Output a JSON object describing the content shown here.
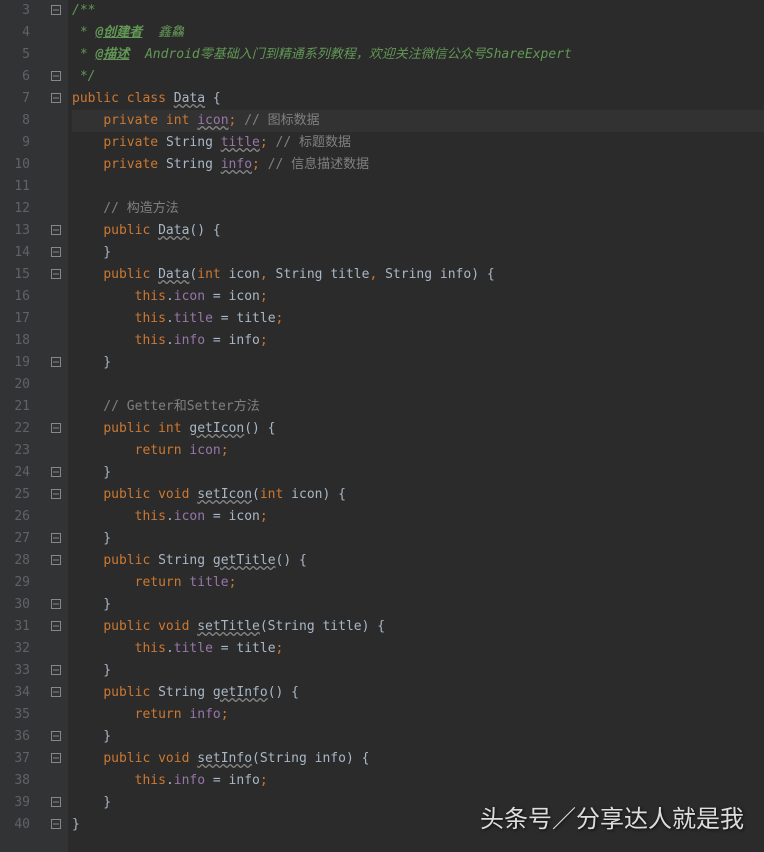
{
  "lineStart": 3,
  "lineEnd": 40,
  "highlightedLine": 8,
  "foldIcons": [
    {
      "line": 3,
      "type": "open"
    },
    {
      "line": 6,
      "type": "close"
    },
    {
      "line": 7,
      "type": "open"
    },
    {
      "line": 13,
      "type": "open"
    },
    {
      "line": 14,
      "type": "close"
    },
    {
      "line": 15,
      "type": "open"
    },
    {
      "line": 19,
      "type": "close"
    },
    {
      "line": 22,
      "type": "open"
    },
    {
      "line": 24,
      "type": "close"
    },
    {
      "line": 25,
      "type": "open"
    },
    {
      "line": 27,
      "type": "close"
    },
    {
      "line": 28,
      "type": "open"
    },
    {
      "line": 30,
      "type": "close"
    },
    {
      "line": 31,
      "type": "open"
    },
    {
      "line": 33,
      "type": "close"
    },
    {
      "line": 34,
      "type": "open"
    },
    {
      "line": 36,
      "type": "close"
    },
    {
      "line": 37,
      "type": "open"
    },
    {
      "line": 39,
      "type": "close"
    },
    {
      "line": 40,
      "type": "close"
    }
  ],
  "code": [
    {
      "n": 3,
      "tokens": [
        {
          "t": "/**",
          "c": "c-doc"
        }
      ]
    },
    {
      "n": 4,
      "tokens": [
        {
          "t": " * ",
          "c": "c-doc"
        },
        {
          "t": "@创建者",
          "c": "c-doctag"
        },
        {
          "t": "  鑫鱻",
          "c": "c-doc"
        }
      ]
    },
    {
      "n": 5,
      "tokens": [
        {
          "t": " * ",
          "c": "c-doc"
        },
        {
          "t": "@描述",
          "c": "c-doctag"
        },
        {
          "t": "  Android零基础入门到精通系列教程，欢迎关注微信公众号ShareExpert",
          "c": "c-doc"
        }
      ]
    },
    {
      "n": 6,
      "tokens": [
        {
          "t": " */",
          "c": "c-doc"
        }
      ]
    },
    {
      "n": 7,
      "tokens": [
        {
          "t": "public class ",
          "c": "c-keyword"
        },
        {
          "t": "Data",
          "c": "c-plain c-underline"
        },
        {
          "t": " {",
          "c": "c-plain"
        }
      ]
    },
    {
      "n": 8,
      "tokens": [
        {
          "t": "    ",
          "c": ""
        },
        {
          "t": "private int ",
          "c": "c-keyword"
        },
        {
          "t": "icon",
          "c": "c-field c-underline"
        },
        {
          "t": ";",
          "c": "c-semicolon"
        },
        {
          "t": " // 图标数据",
          "c": "c-comment"
        }
      ]
    },
    {
      "n": 9,
      "tokens": [
        {
          "t": "    ",
          "c": ""
        },
        {
          "t": "private ",
          "c": "c-keyword"
        },
        {
          "t": "String ",
          "c": "c-plain"
        },
        {
          "t": "title",
          "c": "c-field c-underline"
        },
        {
          "t": ";",
          "c": "c-semicolon"
        },
        {
          "t": " // 标题数据",
          "c": "c-comment"
        }
      ]
    },
    {
      "n": 10,
      "tokens": [
        {
          "t": "    ",
          "c": ""
        },
        {
          "t": "private ",
          "c": "c-keyword"
        },
        {
          "t": "String ",
          "c": "c-plain"
        },
        {
          "t": "info",
          "c": "c-field c-underline"
        },
        {
          "t": ";",
          "c": "c-semicolon"
        },
        {
          "t": " // 信息描述数据",
          "c": "c-comment"
        }
      ]
    },
    {
      "n": 11,
      "tokens": []
    },
    {
      "n": 12,
      "tokens": [
        {
          "t": "    // 构造方法",
          "c": "c-comment"
        }
      ]
    },
    {
      "n": 13,
      "tokens": [
        {
          "t": "    ",
          "c": ""
        },
        {
          "t": "public ",
          "c": "c-keyword"
        },
        {
          "t": "Data",
          "c": "c-plain c-underline"
        },
        {
          "t": "() {",
          "c": "c-plain"
        }
      ]
    },
    {
      "n": 14,
      "tokens": [
        {
          "t": "    }",
          "c": "c-plain"
        }
      ]
    },
    {
      "n": 15,
      "tokens": [
        {
          "t": "    ",
          "c": ""
        },
        {
          "t": "public ",
          "c": "c-keyword"
        },
        {
          "t": "Data",
          "c": "c-plain c-underline"
        },
        {
          "t": "(",
          "c": "c-plain"
        },
        {
          "t": "int ",
          "c": "c-keyword"
        },
        {
          "t": "icon",
          "c": "c-plain"
        },
        {
          "t": ", ",
          "c": "c-semicolon"
        },
        {
          "t": "String title",
          "c": "c-plain"
        },
        {
          "t": ", ",
          "c": "c-semicolon"
        },
        {
          "t": "String info) {",
          "c": "c-plain"
        }
      ]
    },
    {
      "n": 16,
      "tokens": [
        {
          "t": "        ",
          "c": ""
        },
        {
          "t": "this",
          "c": "c-keyword"
        },
        {
          "t": ".",
          "c": "c-dot"
        },
        {
          "t": "icon",
          "c": "c-field"
        },
        {
          "t": " = icon",
          "c": "c-plain"
        },
        {
          "t": ";",
          "c": "c-semicolon"
        }
      ]
    },
    {
      "n": 17,
      "tokens": [
        {
          "t": "        ",
          "c": ""
        },
        {
          "t": "this",
          "c": "c-keyword"
        },
        {
          "t": ".",
          "c": "c-dot"
        },
        {
          "t": "title",
          "c": "c-field"
        },
        {
          "t": " = title",
          "c": "c-plain"
        },
        {
          "t": ";",
          "c": "c-semicolon"
        }
      ]
    },
    {
      "n": 18,
      "tokens": [
        {
          "t": "        ",
          "c": ""
        },
        {
          "t": "this",
          "c": "c-keyword"
        },
        {
          "t": ".",
          "c": "c-dot"
        },
        {
          "t": "info",
          "c": "c-field"
        },
        {
          "t": " = info",
          "c": "c-plain"
        },
        {
          "t": ";",
          "c": "c-semicolon"
        }
      ]
    },
    {
      "n": 19,
      "tokens": [
        {
          "t": "    }",
          "c": "c-plain"
        }
      ]
    },
    {
      "n": 20,
      "tokens": []
    },
    {
      "n": 21,
      "tokens": [
        {
          "t": "    // Getter和Setter方法",
          "c": "c-comment"
        }
      ]
    },
    {
      "n": 22,
      "tokens": [
        {
          "t": "    ",
          "c": ""
        },
        {
          "t": "public int ",
          "c": "c-keyword"
        },
        {
          "t": "getIcon",
          "c": "c-plain c-underline"
        },
        {
          "t": "() {",
          "c": "c-plain"
        }
      ]
    },
    {
      "n": 23,
      "tokens": [
        {
          "t": "        ",
          "c": ""
        },
        {
          "t": "return ",
          "c": "c-keyword"
        },
        {
          "t": "icon",
          "c": "c-field"
        },
        {
          "t": ";",
          "c": "c-semicolon"
        }
      ]
    },
    {
      "n": 24,
      "tokens": [
        {
          "t": "    }",
          "c": "c-plain"
        }
      ]
    },
    {
      "n": 25,
      "tokens": [
        {
          "t": "    ",
          "c": ""
        },
        {
          "t": "public void ",
          "c": "c-keyword"
        },
        {
          "t": "setIcon",
          "c": "c-plain c-underline"
        },
        {
          "t": "(",
          "c": "c-plain"
        },
        {
          "t": "int ",
          "c": "c-keyword"
        },
        {
          "t": "icon) {",
          "c": "c-plain"
        }
      ]
    },
    {
      "n": 26,
      "tokens": [
        {
          "t": "        ",
          "c": ""
        },
        {
          "t": "this",
          "c": "c-keyword"
        },
        {
          "t": ".",
          "c": "c-dot"
        },
        {
          "t": "icon",
          "c": "c-field"
        },
        {
          "t": " = icon",
          "c": "c-plain"
        },
        {
          "t": ";",
          "c": "c-semicolon"
        }
      ]
    },
    {
      "n": 27,
      "tokens": [
        {
          "t": "    }",
          "c": "c-plain"
        }
      ]
    },
    {
      "n": 28,
      "tokens": [
        {
          "t": "    ",
          "c": ""
        },
        {
          "t": "public ",
          "c": "c-keyword"
        },
        {
          "t": "String ",
          "c": "c-plain"
        },
        {
          "t": "getTitle",
          "c": "c-plain c-underline"
        },
        {
          "t": "() {",
          "c": "c-plain"
        }
      ]
    },
    {
      "n": 29,
      "tokens": [
        {
          "t": "        ",
          "c": ""
        },
        {
          "t": "return ",
          "c": "c-keyword"
        },
        {
          "t": "title",
          "c": "c-field"
        },
        {
          "t": ";",
          "c": "c-semicolon"
        }
      ]
    },
    {
      "n": 30,
      "tokens": [
        {
          "t": "    }",
          "c": "c-plain"
        }
      ]
    },
    {
      "n": 31,
      "tokens": [
        {
          "t": "    ",
          "c": ""
        },
        {
          "t": "public void ",
          "c": "c-keyword"
        },
        {
          "t": "setTitle",
          "c": "c-plain c-underline"
        },
        {
          "t": "(String title) {",
          "c": "c-plain"
        }
      ]
    },
    {
      "n": 32,
      "tokens": [
        {
          "t": "        ",
          "c": ""
        },
        {
          "t": "this",
          "c": "c-keyword"
        },
        {
          "t": ".",
          "c": "c-dot"
        },
        {
          "t": "title",
          "c": "c-field"
        },
        {
          "t": " = title",
          "c": "c-plain"
        },
        {
          "t": ";",
          "c": "c-semicolon"
        }
      ]
    },
    {
      "n": 33,
      "tokens": [
        {
          "t": "    }",
          "c": "c-plain"
        }
      ]
    },
    {
      "n": 34,
      "tokens": [
        {
          "t": "    ",
          "c": ""
        },
        {
          "t": "public ",
          "c": "c-keyword"
        },
        {
          "t": "String ",
          "c": "c-plain"
        },
        {
          "t": "getInfo",
          "c": "c-plain c-underline"
        },
        {
          "t": "() {",
          "c": "c-plain"
        }
      ]
    },
    {
      "n": 35,
      "tokens": [
        {
          "t": "        ",
          "c": ""
        },
        {
          "t": "return ",
          "c": "c-keyword"
        },
        {
          "t": "info",
          "c": "c-field"
        },
        {
          "t": ";",
          "c": "c-semicolon"
        }
      ]
    },
    {
      "n": 36,
      "tokens": [
        {
          "t": "    }",
          "c": "c-plain"
        }
      ]
    },
    {
      "n": 37,
      "tokens": [
        {
          "t": "    ",
          "c": ""
        },
        {
          "t": "public void ",
          "c": "c-keyword"
        },
        {
          "t": "setInfo",
          "c": "c-plain c-underline"
        },
        {
          "t": "(String info) {",
          "c": "c-plain"
        }
      ]
    },
    {
      "n": 38,
      "tokens": [
        {
          "t": "        ",
          "c": ""
        },
        {
          "t": "this",
          "c": "c-keyword"
        },
        {
          "t": ".",
          "c": "c-dot"
        },
        {
          "t": "info",
          "c": "c-field"
        },
        {
          "t": " = info",
          "c": "c-plain"
        },
        {
          "t": ";",
          "c": "c-semicolon"
        }
      ]
    },
    {
      "n": 39,
      "tokens": [
        {
          "t": "    }",
          "c": "c-plain"
        }
      ]
    },
    {
      "n": 40,
      "tokens": [
        {
          "t": "}",
          "c": "c-plain"
        }
      ]
    }
  ],
  "watermark": "头条号／分享达人就是我"
}
